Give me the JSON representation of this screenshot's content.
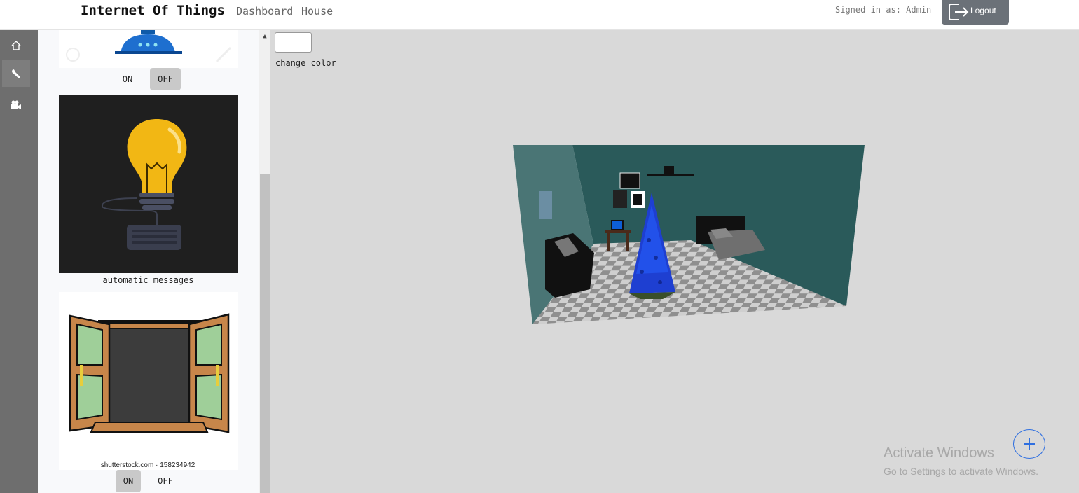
{
  "header": {
    "brand": "Internet Of Things",
    "nav": [
      "Dashboard",
      "House"
    ],
    "signed_in": "Signed in as: Admin",
    "logout_label": "Logout"
  },
  "sidebar_icons": [
    "home-icon",
    "wrench-icon",
    "video-camera-icon"
  ],
  "devices": [
    {
      "name": "",
      "toggle_on": "ON",
      "toggle_off": "OFF",
      "state": "OFF"
    },
    {
      "name": "automatic messages"
    },
    {
      "name": "",
      "image_text": "shutterstock.com · 158234942",
      "toggle_on": "ON",
      "toggle_off": "OFF",
      "state": "ON"
    }
  ],
  "scene": {
    "change_color_label": "change color"
  },
  "watermark": {
    "line1": "Activate Windows",
    "line2": "Go to Settings to activate Windows."
  },
  "colors": {
    "accent": "#2f6fe0",
    "sidebar": "#6e6e6e",
    "logout_bg": "#6b7178",
    "wall": "#2a5a5a"
  }
}
